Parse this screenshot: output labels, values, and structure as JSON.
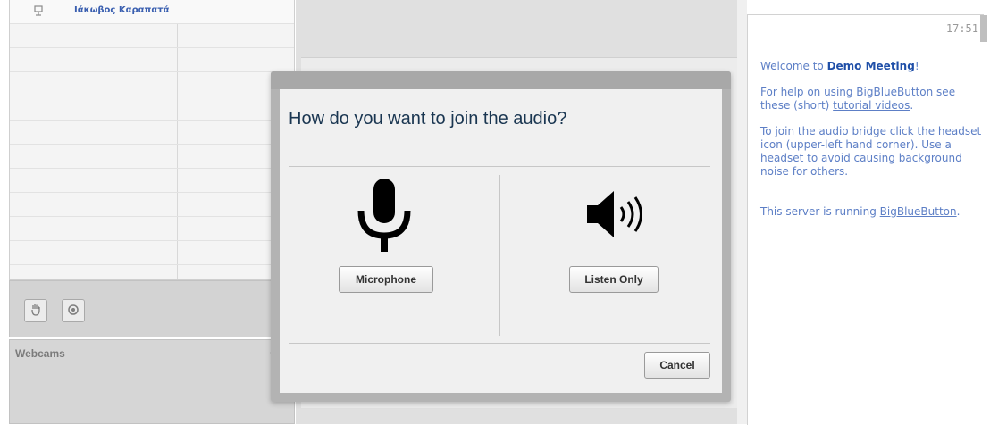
{
  "users": {
    "user_list": [
      {
        "name": "Ιάκωβος Καραπατά",
        "icon": "user-icon"
      }
    ],
    "toolbar": [
      {
        "icon": "raise-hand-icon"
      },
      {
        "icon": "settings-gear-icon"
      }
    ]
  },
  "webcams": {
    "title": "Webcams",
    "minimize_label": "–"
  },
  "chat": {
    "time": "17:51",
    "welcome_prefix": "Welcome to ",
    "meeting_name": "Demo Meeting",
    "welcome_suffix": "!",
    "help_text": "For help on using BigBlueButton see these (short) ",
    "tutorial_link": "tutorial videos",
    "help_suffix": ".",
    "audio_help": "To join the audio bridge click the headset icon (upper-left hand corner).  Use a headset to avoid causing background noise for others.",
    "server_text": "This server is running ",
    "server_link": "BigBlueButton",
    "server_suffix": "."
  },
  "dialog": {
    "title": "How do you want to join the audio?",
    "microphone_label": "Microphone",
    "listen_only_label": "Listen Only",
    "cancel_label": "Cancel",
    "microphone_icon": "microphone-icon",
    "speaker_icon": "speaker-icon"
  }
}
